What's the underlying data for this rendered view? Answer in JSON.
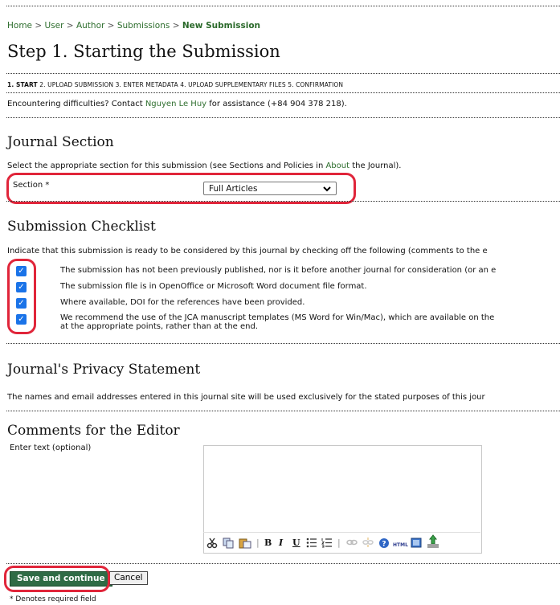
{
  "breadcrumb": {
    "home": "Home",
    "user": "User",
    "author": "Author",
    "submissions": "Submissions",
    "current": "New Submission",
    "sep": ">"
  },
  "page_title": "Step 1. Starting the Submission",
  "steps": {
    "s1": "1. START",
    "s2": "2. UPLOAD SUBMISSION",
    "s3": "3. ENTER METADATA",
    "s4": "4. UPLOAD SUPPLEMENTARY FILES",
    "s5": "5. CONFIRMATION"
  },
  "contact": {
    "prefix": "Encountering difficulties? Contact",
    "name": "Nguyen Le Huy",
    "suffix": "for assistance (+84 904 378 218)."
  },
  "journal_section": {
    "heading": "Journal Section",
    "instruction_prefix": "Select the appropriate section for this submission (see Sections and Policies in",
    "instruction_link": "About",
    "instruction_suffix": "the Journal).",
    "section_label": "Section *",
    "section_value": "Full Articles"
  },
  "checklist": {
    "heading": "Submission Checklist",
    "intro": "Indicate that this submission is ready to be considered by this journal by checking off the following (comments to the e",
    "items": [
      "The submission has not been previously published, nor is it before another journal for consideration (or an e",
      "The submission file is in OpenOffice or Microsoft Word document file format.",
      "Where available, DOI for the references have been provided.",
      "We recommend the use of the JCA manuscript templates (MS Word for Win/Mac), which are available on the"
    ],
    "item4_line2": "at the appropriate points, rather than at the end."
  },
  "privacy": {
    "heading": "Journal's Privacy Statement",
    "text": "The names and email addresses entered in this journal site will be used exclusively for the stated purposes of this jour"
  },
  "comments": {
    "heading": "Comments for the Editor",
    "label": "Enter text (optional)"
  },
  "buttons": {
    "save": "Save and continue",
    "cancel": "Cancel"
  },
  "required_note": "* Denotes required field",
  "colors": {
    "accent_green": "#2f6b45",
    "highlight_red": "#e0253a",
    "checkbox_blue": "#1a73e8"
  }
}
